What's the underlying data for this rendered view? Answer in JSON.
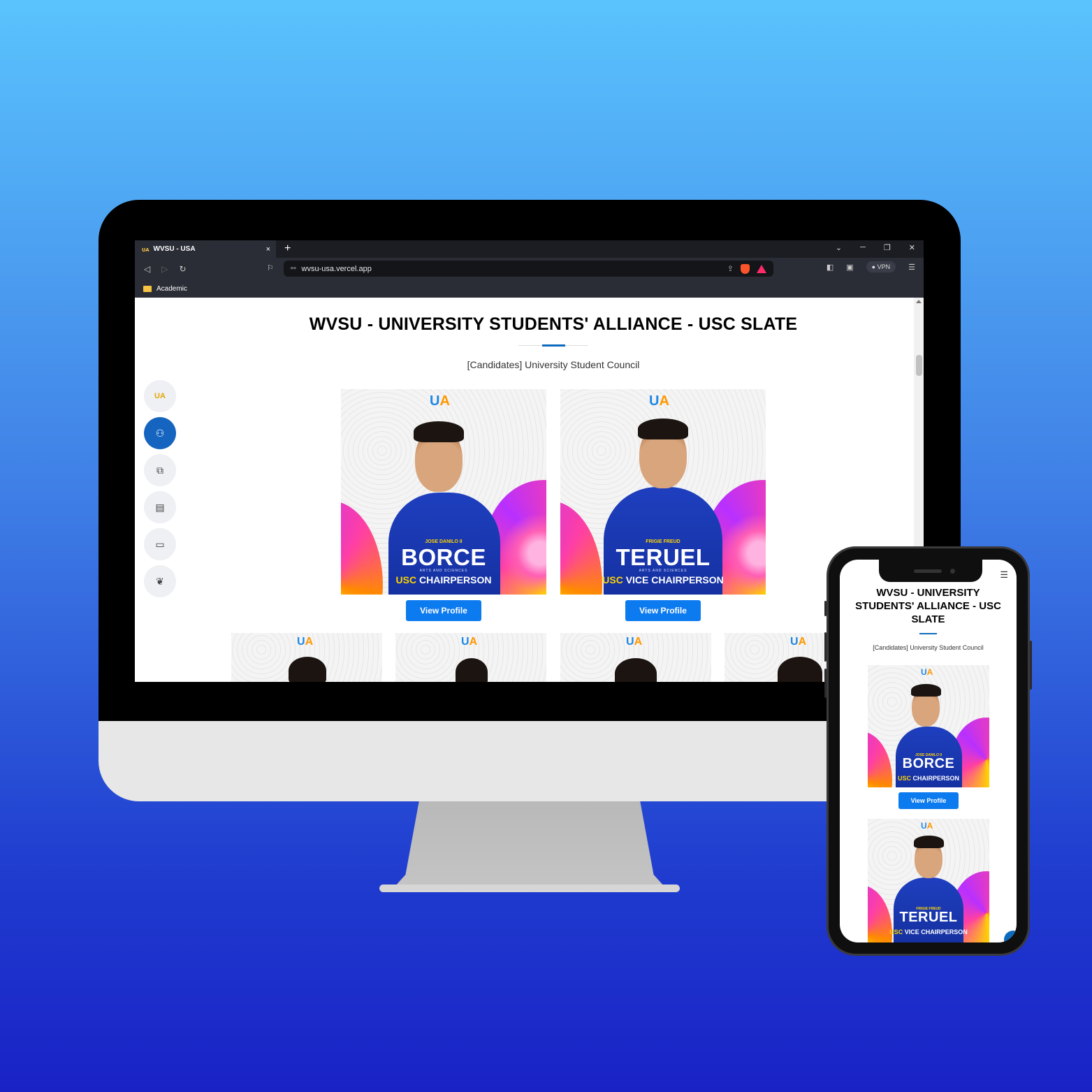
{
  "browser": {
    "tab_title": "WVSU - USA",
    "tab_close": "×",
    "new_tab": "+",
    "url": "wvsu-usa.vercel.app",
    "vpn_label": "VPN",
    "bookmark_folder": "Academic"
  },
  "page": {
    "title": "WVSU - UNIVERSITY STUDENTS' ALLIANCE - USC SLATE",
    "subtitle": "[Candidates] University Student Council",
    "logo_text": "UA"
  },
  "candidates": [
    {
      "first_name": "JOSE DANILO II",
      "last_name": "BORCE",
      "college": "ARTS AND SCIENCES",
      "role_prefix": "USC",
      "role": "CHAIRPERSON",
      "button": "View Profile"
    },
    {
      "first_name": "FRIGIE FREUD",
      "last_name": "TERUEL",
      "college": "ARTS AND SCIENCES",
      "role_prefix": "USC",
      "role": "VICE CHAIRPERSON",
      "button": "View Profile"
    }
  ],
  "mobile": {
    "title": "WVSU - UNIVERSITY STUDENTS' ALLIANCE - USC SLATE",
    "subtitle": "[Candidates] University Student Council",
    "button": "View Profile",
    "menu_icon": "hamburger-icon",
    "scroll_top_icon": "arrow-up-icon"
  },
  "colors": {
    "accent": "#0d6bbd",
    "button": "#0d7bf0",
    "background_top": "#5ac3fd",
    "background_bottom": "#1a22c6"
  }
}
